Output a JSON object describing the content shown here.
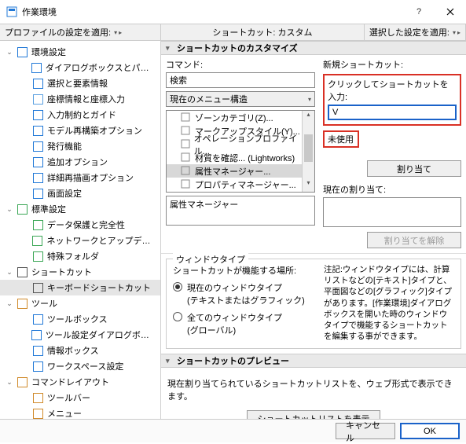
{
  "window": {
    "title": "作業環境"
  },
  "topbar": {
    "profile_label": "プロファイルの設定を適用:",
    "center": "ショートカット: カスタム",
    "apply_label": "選択した設定を適用:"
  },
  "tree": [
    {
      "level": 1,
      "expand": "v",
      "label": "環境設定",
      "color": "#2078d7"
    },
    {
      "level": 2,
      "label": "ダイアログボックスとパレット",
      "color": "#2078d7"
    },
    {
      "level": 2,
      "label": "選択と要素情報",
      "color": "#2078d7"
    },
    {
      "level": 2,
      "label": "座標情報と座標入力",
      "color": "#5aa0e0"
    },
    {
      "level": 2,
      "label": "入力制約とガイド",
      "color": "#2078d7"
    },
    {
      "level": 2,
      "label": "モデル再構築オプション",
      "color": "#2078d7"
    },
    {
      "level": 2,
      "label": "発行機能",
      "color": "#2078d7"
    },
    {
      "level": 2,
      "label": "追加オプション",
      "color": "#2078d7"
    },
    {
      "level": 2,
      "label": "詳細再描画オプション",
      "color": "#2078d7"
    },
    {
      "level": 2,
      "label": "画面設定",
      "color": "#2078d7"
    },
    {
      "level": 1,
      "expand": "v",
      "label": "標準設定",
      "color": "#3aa655"
    },
    {
      "level": 2,
      "label": "データ保護と完全性",
      "color": "#3aa655"
    },
    {
      "level": 2,
      "label": "ネットワークとアップデート",
      "color": "#3aa655"
    },
    {
      "level": 2,
      "label": "特殊フォルダ",
      "color": "#3aa655"
    },
    {
      "level": 1,
      "expand": "v",
      "label": "ショートカット",
      "color": "#555"
    },
    {
      "level": 2,
      "label": "キーボードショートカット",
      "color": "#555",
      "selected": true
    },
    {
      "level": 1,
      "expand": "v",
      "label": "ツール",
      "color": "#d08a2a"
    },
    {
      "level": 2,
      "label": "ツールボックス",
      "color": "#2078d7"
    },
    {
      "level": 2,
      "label": "ツール設定ダイアログボックス",
      "color": "#2078d7"
    },
    {
      "level": 2,
      "label": "情報ボックス",
      "color": "#2078d7"
    },
    {
      "level": 2,
      "label": "ワークスペース設定",
      "color": "#2078d7"
    },
    {
      "level": 1,
      "expand": "v",
      "label": "コマンドレイアウト",
      "color": "#d08a2a"
    },
    {
      "level": 2,
      "label": "ツールバー",
      "color": "#d08a2a"
    },
    {
      "level": 2,
      "label": "メニュー",
      "color": "#d08a2a"
    }
  ],
  "sections": {
    "customize": "ショートカットのカスタマイズ",
    "preview": "ショートカットのプレビュー"
  },
  "cmd": {
    "label": "コマンド:",
    "search": "検索",
    "combo": "現在のメニュー構造",
    "items": [
      {
        "label": "ゾーンカテゴリ(Z)..."
      },
      {
        "label": "マークアップスタイル(Y)..."
      },
      {
        "label": "オペレーションプロファイル..."
      },
      {
        "label": "材質を確認... (Lightworks)"
      },
      {
        "label": "属性マネージャー...",
        "selected": true
      },
      {
        "label": "プロパティマネージャー..."
      }
    ],
    "selected_name": "属性マネージャー"
  },
  "new": {
    "label": "新規ショートカット:",
    "hint": "クリックしてショートカットを入力:",
    "value": "V",
    "status": "未使用",
    "assign_btn": "割り当て",
    "current_label": "現在の割り当て:",
    "unassign_btn": "割り当てを解除"
  },
  "wintype": {
    "legend": "ウィンドウタイプ",
    "sub": "ショートカットが機能する場所:",
    "opt1_a": "現在のウィンドウタイプ",
    "opt1_b": "(テキストまたはグラフィック)",
    "opt2_a": "全てのウィンドウタイプ",
    "opt2_b": "(グローバル)",
    "note": "注記:ウィンドウタイプには、計算リストなどの[テキスト]タイプと、平面図などの[グラフィック]タイプがあります。[作業環境]ダイアログボックスを開いた時のウィンドウタイプで機能するショートカットを編集する事ができます。"
  },
  "preview": {
    "desc": "現在割り当てられているショートカットリストを、ウェブ形式で表示できます。",
    "btn": "ショートカットリストを表示"
  },
  "bottom": {
    "cancel": "キャンセル",
    "ok": "OK"
  }
}
